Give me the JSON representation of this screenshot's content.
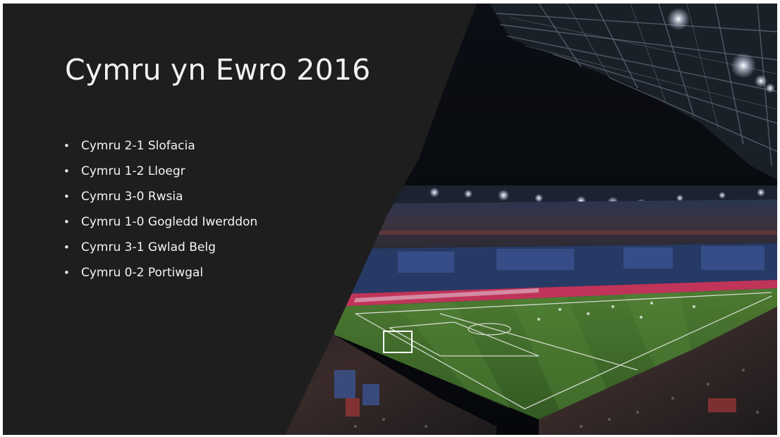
{
  "slide": {
    "title": "Cymru yn Ewro 2016",
    "bullet_glyph": "•",
    "results": [
      "Cymru 2-1 Slofacia",
      "Cymru 1-2 Lloegr",
      "Cymru 3-0 Rwsia",
      "Cymru 1-0 Gogledd Iwerddon",
      "Cymru 3-1 Gwlad Belg",
      "Cymru 0-2 Portiwgal"
    ]
  },
  "image": {
    "subject": "stadium-photo"
  },
  "colors": {
    "panel_background": "#1e1e1e",
    "title_text": "#f2f2f2",
    "body_text": "#f4f4f4",
    "pitch_green": "#3f6a2a",
    "night_sky": "#07090d"
  }
}
